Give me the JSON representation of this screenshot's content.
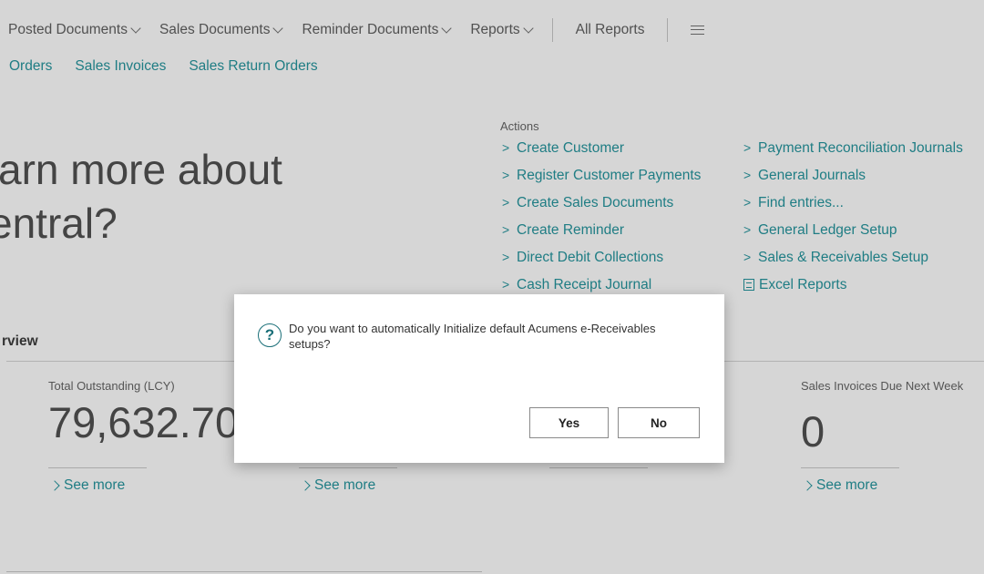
{
  "nav": {
    "items": [
      {
        "label": "Posted Documents"
      },
      {
        "label": "Sales Documents"
      },
      {
        "label": "Reminder Documents"
      },
      {
        "label": "Reports"
      }
    ],
    "all_reports": "All Reports"
  },
  "subnav": [
    "Orders",
    "Sales Invoices",
    "Sales Return Orders"
  ],
  "headline": {
    "line1": "arn more about",
    "line2": "entral?"
  },
  "actions": {
    "label": "Actions",
    "col1": [
      "Create Customer",
      "Register Customer Payments",
      "Create Sales Documents",
      "Create Reminder",
      "Direct Debit Collections",
      "Cash Receipt Journal"
    ],
    "col2": [
      "Payment Reconciliation Journals",
      "General Journals",
      "Find entries...",
      "General Ledger Setup",
      "Sales & Receivables Setup"
    ],
    "excel": "Excel Reports"
  },
  "overview": {
    "title": "rview",
    "tiles": [
      {
        "label": "Total Outstanding (LCY)",
        "value": "79,632.70",
        "link": "See more"
      },
      {
        "label": "",
        "value": "",
        "link": "See more"
      },
      {
        "label": "Sales Invoices Due Next Week",
        "value": "0",
        "link": "See more"
      }
    ]
  },
  "dialog": {
    "icon": "question-icon",
    "message": "Do you want to automatically Initialize default Acumens e-Receivables setups?",
    "yes": "Yes",
    "no": "No"
  }
}
